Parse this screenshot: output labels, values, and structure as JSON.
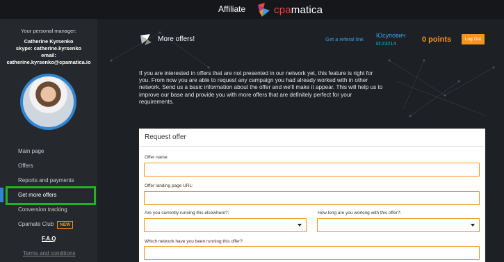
{
  "topbar": {
    "affiliate_label": "Affiliate",
    "logo_cp": "cpa",
    "logo_rest": "matica"
  },
  "sidebar": {
    "manager_title": "Your personal manager:",
    "manager_name": "Catherine Kyrsenko",
    "skype": "skype: catherine.kyrsenko",
    "email_label": "email:",
    "email": "catherine.kyrsenko@cpamatica.io",
    "menu": [
      {
        "label": "Main page"
      },
      {
        "label": "Offers"
      },
      {
        "label": "Reports and payments"
      },
      {
        "label": "Get more offers"
      },
      {
        "label": "Conversion tracking"
      },
      {
        "label": "Cpamate Club",
        "badge": "NEW"
      },
      {
        "label": "F.A.Q"
      },
      {
        "label": "Terms and conditions"
      }
    ]
  },
  "header": {
    "page_title": "More offers!",
    "referral_link": "Get a referal link",
    "user_name": "Юсупович",
    "user_id": "id:23214",
    "points": "0 points",
    "logout": "Log Out"
  },
  "intro": "If you are interested in offers that are not presented in our network yet, this feature is right for you. From now you are able to request any campaign you had already worked with in other network. Send us a basic information about the offer and we'll make it appear. This will help us to improve our base and provide you with more offers that are definitely perfect for your requirements.",
  "form": {
    "title": "Request offer",
    "offer_name_label": "Offer name:",
    "landing_label": "Offer landing page URL:",
    "running_label": "Are you currently running this elsewhere?:",
    "how_long_label": "How long are you working with this offer?:",
    "network_label": "Which network have you been running this offer?:"
  },
  "colors": {
    "accent_orange": "#f7941d",
    "link_blue": "#3aa0e6",
    "active_blue": "#2f86d4",
    "highlight_green": "#22b322"
  }
}
